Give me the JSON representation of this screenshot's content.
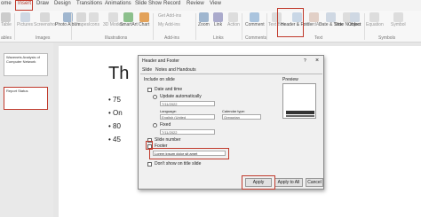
{
  "tabs": [
    "ome",
    "Insert",
    "Draw",
    "Design",
    "Transitions",
    "Animations",
    "Slide Show",
    "Record",
    "Review",
    "View"
  ],
  "ribbon": {
    "table": "Table",
    "tables_group": "ables",
    "pictures": "Pictures",
    "screenshot": "Screenshot",
    "photo_album": "Photo Album",
    "images_group": "Images",
    "shapes": "Shapes",
    "icons": "Icons",
    "models": "3D Models",
    "smartart": "SmartArt",
    "chart": "Chart",
    "illustrations_group": "Illustrations",
    "get_addins": "Get Add-ins",
    "my_addins": "My Add-ins",
    "addins_group": "Add-ins",
    "zoom": "Zoom",
    "link": "Link",
    "action": "Action",
    "links_group": "Links",
    "comment": "Comment",
    "comments_group": "Comments",
    "text_box": "Text Box",
    "header_footer": "Header & Footer",
    "wordart": "WordArt",
    "date_time": "Date & Time",
    "slide_number": "Slide Number",
    "object": "Object",
    "text_group": "Text",
    "equation": "Equation",
    "symbol": "Symbol",
    "symbols_group": "Symbols"
  },
  "thumbs": [
    "Wavenets Analysis of Computer Network",
    "Report Status"
  ],
  "slide": {
    "title": "Th",
    "bullets": [
      "75",
      "On",
      "80",
      "45"
    ]
  },
  "dialog": {
    "title": "Header and Footer",
    "help": "?",
    "close": "×",
    "tab_slide": "Slide",
    "tab_notes": "Notes and Handouts",
    "include_label": "Include on slide",
    "date_time": "Date and time",
    "update_auto": "Update automatically",
    "date_value": "7/11/2022",
    "language_label": "Language:",
    "calendar_label": "Calendar type:",
    "language_value": "English (United",
    "calendar_value": "Gregorian",
    "fixed": "Fixed",
    "fixed_value": "7/11/2022",
    "slide_number": "Slide number",
    "footer": "Footer",
    "footer_value": "Lorem ipsum dolor sit amet",
    "dont_show": "Don't show on title slide",
    "preview": "Preview",
    "apply": "Apply",
    "apply_all": "Apply to All",
    "cancel": "Cancel"
  },
  "colors": {
    "highlight": "#c0392b",
    "accent": "#b7472a"
  }
}
